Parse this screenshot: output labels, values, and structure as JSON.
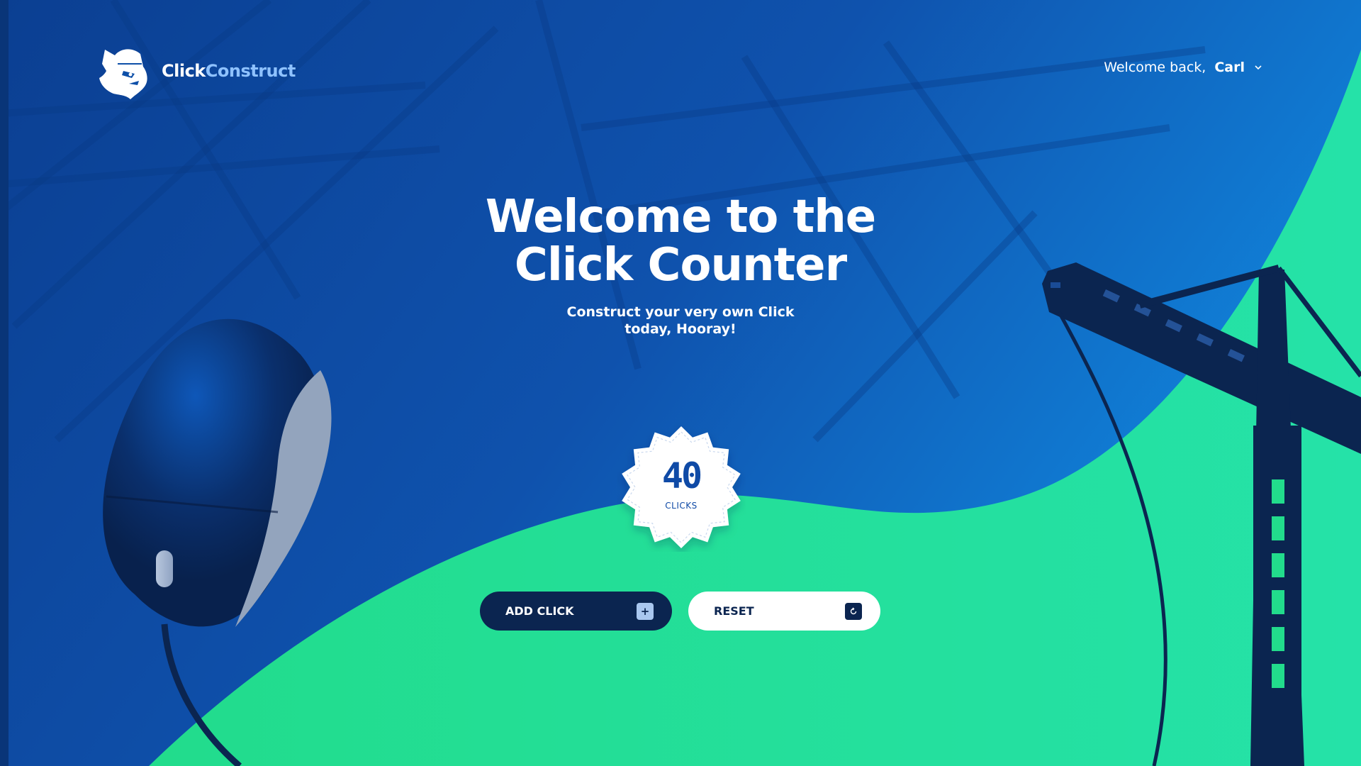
{
  "brand": {
    "name_part1": "Click",
    "name_part2": "Construct"
  },
  "header": {
    "welcome_text": "Welcome back,",
    "user_name": "Carl",
    "user_menu_icon": "chevron-down-icon"
  },
  "hero": {
    "title_line1": "Welcome to the",
    "title_line2": "Click Counter",
    "subtitle_line1": "Construct your very own Click",
    "subtitle_line2": "today, Hooray!"
  },
  "counter": {
    "value": "40",
    "unit_label": "CLICKS"
  },
  "actions": {
    "add_label": "ADD CLICK",
    "add_icon": "plus-icon",
    "reset_label": "RESET",
    "reset_icon": "reset-icon"
  },
  "colors": {
    "background_blue": "#0d4fa8",
    "accent_green": "#22dc8c",
    "navy": "#0b2550",
    "light_blue": "#8fc2ff"
  }
}
